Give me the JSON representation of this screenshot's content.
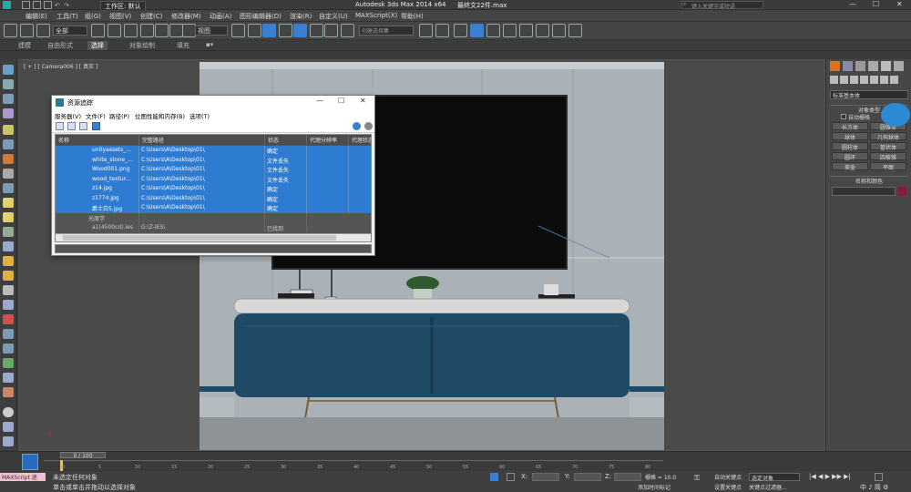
{
  "window": {
    "app_title": "Autodesk 3ds Max  2014 x64",
    "file_title": "最终文22件.max",
    "workspace": "工作区: 默认",
    "search_placeholder": "键入关键字或短语"
  },
  "menu": [
    "编辑(E)",
    "工具(T)",
    "组(G)",
    "视图(V)",
    "创建(C)",
    "修改器(M)",
    "动画(A)",
    "图形编辑器(D)",
    "渲染(R)",
    "自定义(U)",
    "MAXScript(X)",
    "帮助(H)"
  ],
  "toolbar": {
    "selection_filter": "全部",
    "ref_coord": "视图",
    "named_selection": "创建选择集"
  },
  "ribbon_tabs": [
    "建模",
    "自由形式",
    "选择",
    "对象绘制",
    "填充"
  ],
  "viewport": {
    "label": "[ + ] [ Camera006 ] [ 真实 ]"
  },
  "dialog": {
    "title": "资源追踪",
    "menu": [
      "服务器(V)",
      "文件(F)",
      "路径(P)",
      "位图性能和内存(B)",
      "选项(T)"
    ],
    "columns": [
      "名称",
      "完整路径",
      "状态",
      "代理分辨率",
      "代理状态"
    ],
    "rows": [
      {
        "name": "unityassets_...",
        "path": "C:\\Users\\A\\Desktop\\01\\",
        "status": "确定",
        "selected": true
      },
      {
        "name": "white_stone_...",
        "path": "C:\\Users\\A\\Desktop\\01\\",
        "status": "文件丢失",
        "selected": true
      },
      {
        "name": "Wood001.png",
        "path": "C:\\Users\\A\\Desktop\\01\\",
        "status": "文件丢失",
        "selected": true
      },
      {
        "name": "wood_textur...",
        "path": "C:\\Users\\A\\Desktop\\01\\",
        "status": "文件丢失",
        "selected": true
      },
      {
        "name": "z14.jpg",
        "path": "C:\\Users\\A\\Desktop\\01\\",
        "status": "确定",
        "selected": true
      },
      {
        "name": "z1774.jpg",
        "path": "C:\\Users\\A\\Desktop\\01\\",
        "status": "确定",
        "selected": true
      },
      {
        "name": "爵士白5.jpg",
        "path": "C:\\Users\\A\\Desktop\\01\\",
        "status": "确定",
        "selected": true
      }
    ],
    "group_label": "光度学",
    "photometric_row": {
      "name": "a1(4500cd).ies",
      "path": "G:\\Z-IES\\",
      "status": "已找到"
    }
  },
  "command_panel": {
    "dropdown": "标准基本体",
    "rollout_object_type": "对象类型",
    "autogrid": "自动栅格",
    "buttons": [
      "长方体",
      "圆锥体",
      "球体",
      "几何球体",
      "圆柱体",
      "管状体",
      "圆环",
      "四棱锥",
      "茶壶",
      "平面"
    ],
    "rollout_name_color": "名称和颜色"
  },
  "timeline": {
    "frame_display": "0 / 100",
    "ticks": [
      "0",
      "5",
      "10",
      "15",
      "20",
      "25",
      "30",
      "35",
      "40",
      "45",
      "50",
      "55",
      "60",
      "65",
      "70",
      "75",
      "80"
    ]
  },
  "status": {
    "maxscript": "MAXScript 迷",
    "line1": "未选定任何对象",
    "line2": "单击或单击并拖动以选择对象",
    "coord_x": "X:",
    "coord_y": "Y:",
    "coord_z": "Z:",
    "grid": "栅格 = 10.0",
    "auto_key": "自动关键点",
    "set_key": "设置关键点",
    "sel_object": "选定对象",
    "key_filter": "关键点过滤器...",
    "add_time_tag": "添加时间标记"
  },
  "colors": {
    "selection_blue": "#2e7bd2",
    "cabinet_blue": "#1f4a66",
    "app_bg": "#444444"
  }
}
